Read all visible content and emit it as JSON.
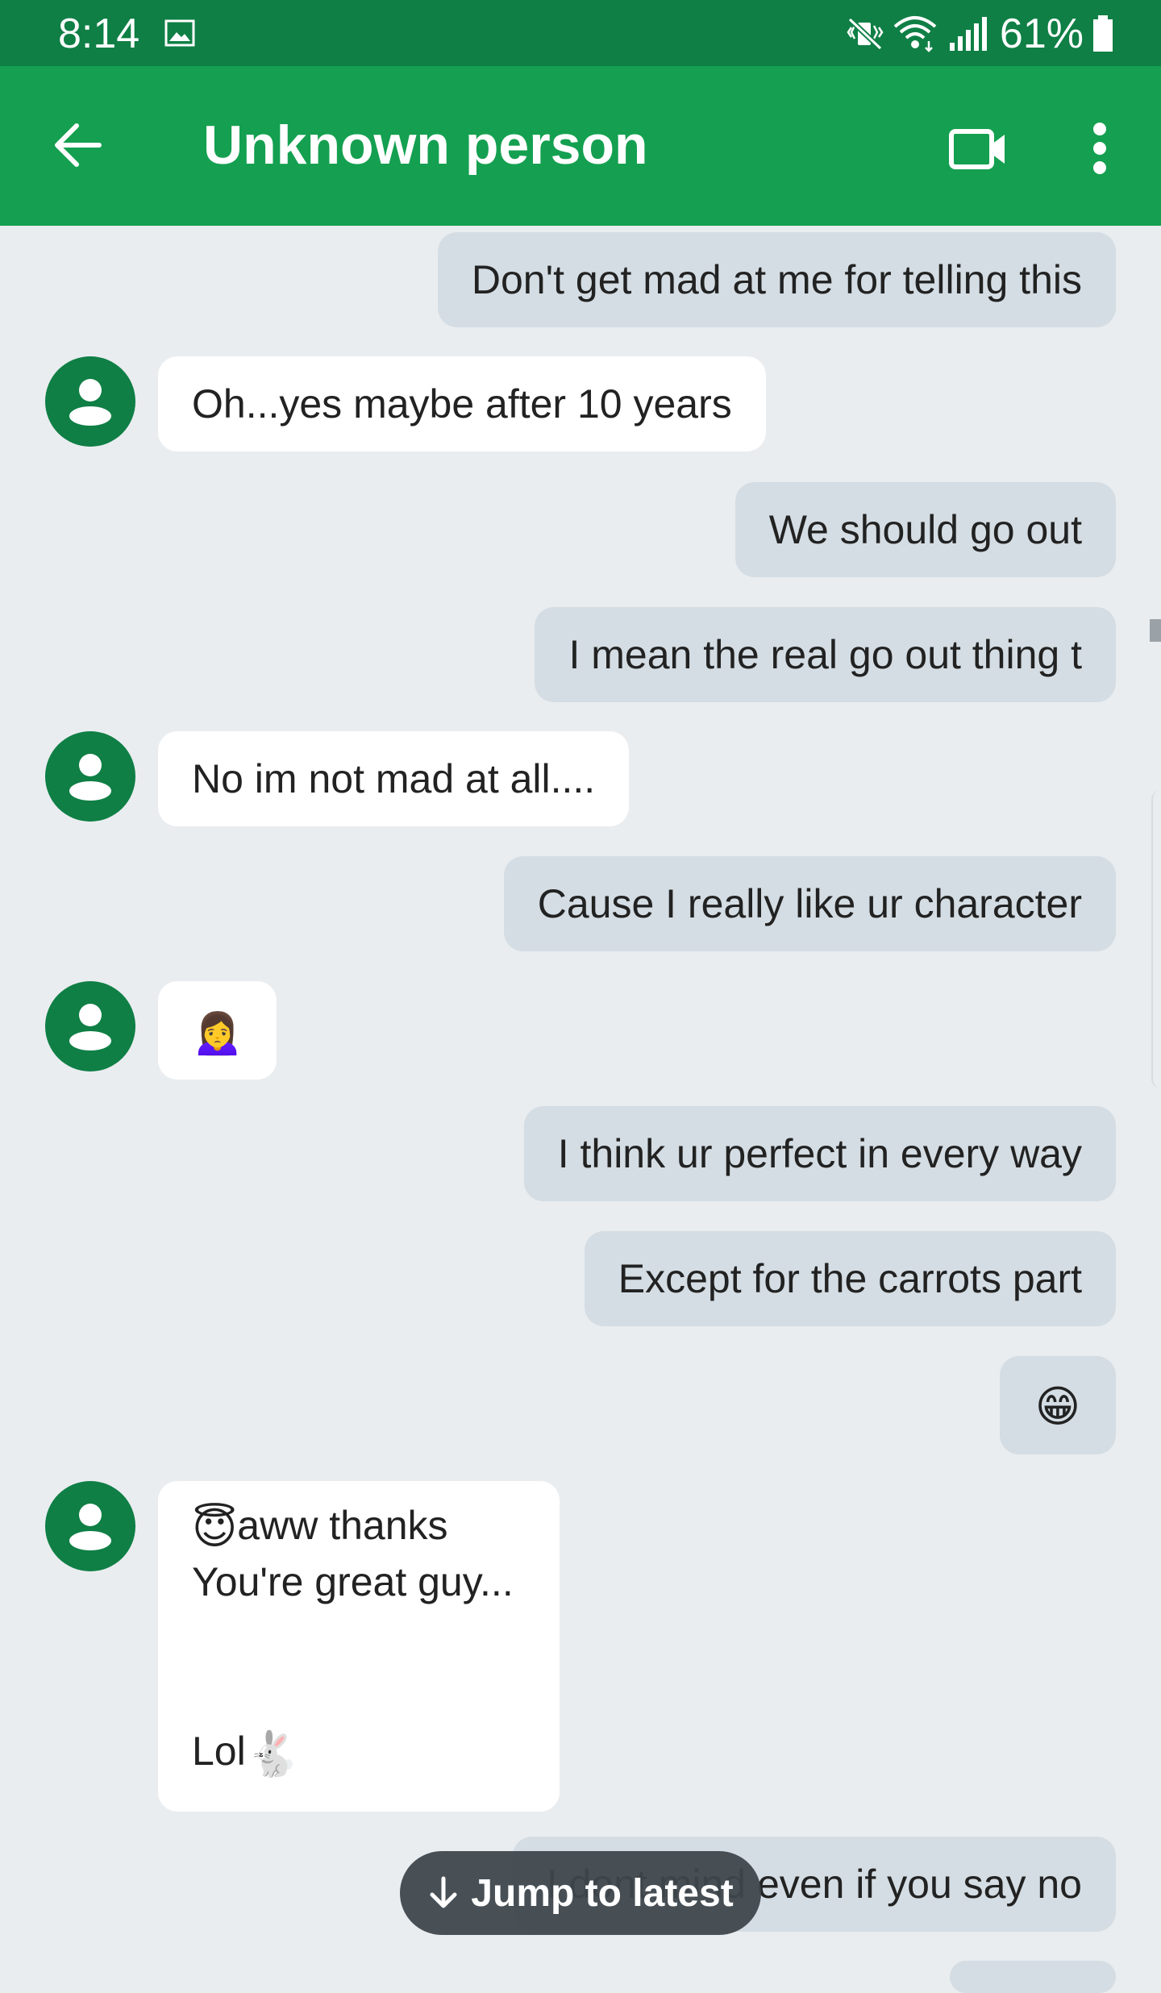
{
  "status_bar": {
    "time": "8:14",
    "battery": "61%"
  },
  "app_bar": {
    "title": "Unknown person",
    "back_icon": "arrow-back-icon",
    "video_icon": "video-call-icon",
    "more_icon": "more-vert-icon"
  },
  "messages": [
    {
      "type": "sent",
      "text": "Don't get mad at me for telling this"
    },
    {
      "type": "received",
      "text": "Oh...yes maybe after 10 years"
    },
    {
      "type": "sent",
      "text": "We should go out"
    },
    {
      "type": "sent",
      "text": "I mean the real go out thing t"
    },
    {
      "type": "received",
      "text": "No im not mad at all...."
    },
    {
      "type": "sent",
      "text": "Cause I really like ur character"
    },
    {
      "type": "received",
      "emoji": "🙍‍♀️"
    },
    {
      "type": "sent",
      "text": "I think ur perfect in every way"
    },
    {
      "type": "sent",
      "text": "Except for the carrots part"
    },
    {
      "type": "sent",
      "emoji": "😁"
    },
    {
      "type": "received",
      "line1_emoji": "😇",
      "line1_text": "aww thanks",
      "line2": "You're great guy...",
      "line3_text": "Lol",
      "line3_emoji": "🐇"
    },
    {
      "type": "sent",
      "text": "I dont mind even if you say no"
    }
  ],
  "jump_to_latest": "Jump to latest",
  "colors": {
    "status_bar": "#0f7f45",
    "app_bar": "#14a050",
    "background": "#e9edf0",
    "sent_bubble": "#d4dde3",
    "received_bubble": "#ffffff",
    "avatar": "#0f7f45"
  }
}
